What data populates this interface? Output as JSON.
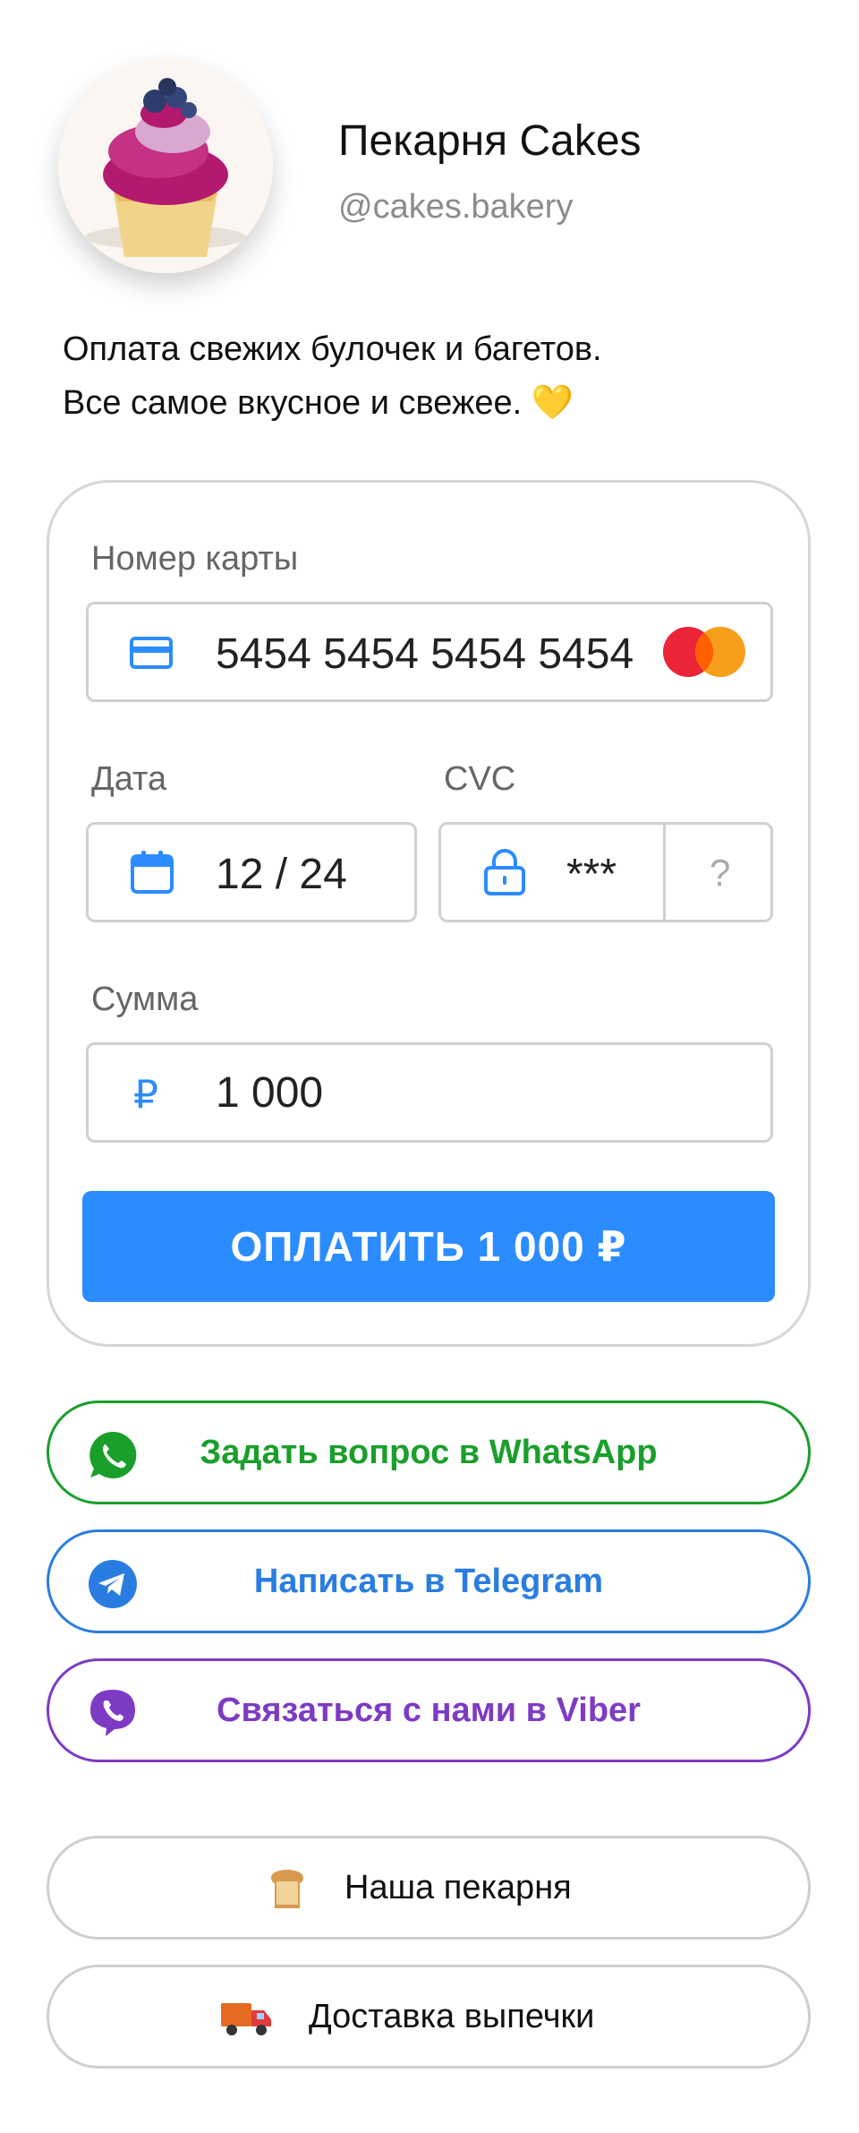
{
  "profile": {
    "name": "Пекарня Cakes",
    "handle": "@cakes.bakery",
    "description_line1": "Оплата свежих булочек и багетов.",
    "description_line2": "Все самое вкусное и свежее. 💛"
  },
  "payment": {
    "card_label": "Номер карты",
    "card_number": "5454 5454 5454 5454",
    "date_label": "Дата",
    "date_value": "12 / 24",
    "cvc_label": "CVC",
    "cvc_value": "***",
    "cvc_help": "?",
    "amount_label": "Сумма",
    "currency_symbol": "₽",
    "amount_value": "1 000",
    "pay_button": "ОПЛАТИТЬ 1 000 ₽"
  },
  "messengers": {
    "whatsapp": "Задать вопрос в WhatsApp",
    "telegram": "Написать в Telegram",
    "viber": "Связаться с нами в Viber"
  },
  "links": {
    "bakery": "Наша пекарня",
    "delivery": "Доставка выпечки"
  },
  "colors": {
    "accent": "#2b8cff",
    "whatsapp": "#1a9f2a",
    "telegram": "#2a7de0",
    "viber": "#7d3bc4"
  }
}
